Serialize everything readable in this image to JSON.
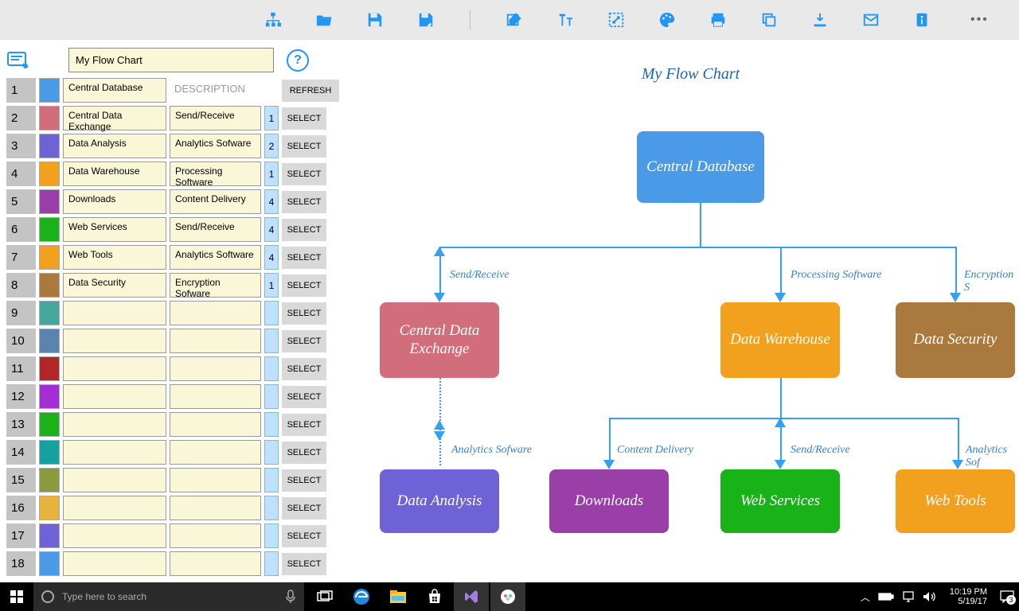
{
  "chart_title": "My Flow Chart",
  "title_input": "My Flow Chart",
  "desc_header": "DESCRIPTION",
  "refresh_label": "REFRESH",
  "select_label": "SELECT",
  "rows": [
    {
      "n": "1",
      "color": "#4a9ae8",
      "name": "Central Database",
      "desc": "",
      "pick": ""
    },
    {
      "n": "2",
      "color": "#d26d7b",
      "name": "Central Data Exchange",
      "desc": "Send/Receive",
      "pick": "1"
    },
    {
      "n": "3",
      "color": "#6e62d6",
      "name": "Data Analysis",
      "desc": "Analytics Sofware",
      "pick": "2"
    },
    {
      "n": "4",
      "color": "#f2a11f",
      "name": "Data Warehouse",
      "desc": "Processing Software",
      "pick": "1"
    },
    {
      "n": "5",
      "color": "#9a3fa7",
      "name": "Downloads",
      "desc": "Content Delivery",
      "pick": "4"
    },
    {
      "n": "6",
      "color": "#19b319",
      "name": "Web Services",
      "desc": "Send/Receive",
      "pick": "4"
    },
    {
      "n": "7",
      "color": "#f2a11f",
      "name": "Web Tools",
      "desc": "Analytics Software",
      "pick": "4"
    },
    {
      "n": "8",
      "color": "#a9793d",
      "name": "Data Security",
      "desc": "Encryption Sofware",
      "pick": "1"
    },
    {
      "n": "9",
      "color": "#44a79d",
      "name": "",
      "desc": "",
      "pick": ""
    },
    {
      "n": "10",
      "color": "#5a84ad",
      "name": "",
      "desc": "",
      "pick": ""
    },
    {
      "n": "11",
      "color": "#b12727",
      "name": "",
      "desc": "",
      "pick": ""
    },
    {
      "n": "12",
      "color": "#a32fd4",
      "name": "",
      "desc": "",
      "pick": ""
    },
    {
      "n": "13",
      "color": "#19b319",
      "name": "",
      "desc": "",
      "pick": ""
    },
    {
      "n": "14",
      "color": "#16a0a0",
      "name": "",
      "desc": "",
      "pick": ""
    },
    {
      "n": "15",
      "color": "#8a9a3d",
      "name": "",
      "desc": "",
      "pick": ""
    },
    {
      "n": "16",
      "color": "#e8b33d",
      "name": "",
      "desc": "",
      "pick": ""
    },
    {
      "n": "17",
      "color": "#6e62d6",
      "name": "",
      "desc": "",
      "pick": ""
    },
    {
      "n": "18",
      "color": "#4a9ae8",
      "name": "",
      "desc": "",
      "pick": ""
    }
  ],
  "nodes": {
    "central_db": "Central Database",
    "cde": "Central Data Exchange",
    "dw": "Data Warehouse",
    "ds": "Data Security",
    "da": "Data Analysis",
    "dl": "Downloads",
    "ws": "Web Services",
    "wt": "Web Tools"
  },
  "edges": {
    "sr": "Send/Receive",
    "ps": "Processing Software",
    "es": "Encryption S",
    "as": "Analytics Sofware",
    "cd": "Content Delivery",
    "sr2": "Send/Receive",
    "as2": "Analytics Sof"
  },
  "taskbar": {
    "search_placeholder": "Type here to search",
    "time": "10:19 PM",
    "date": "5/19/17",
    "badge": "3"
  }
}
